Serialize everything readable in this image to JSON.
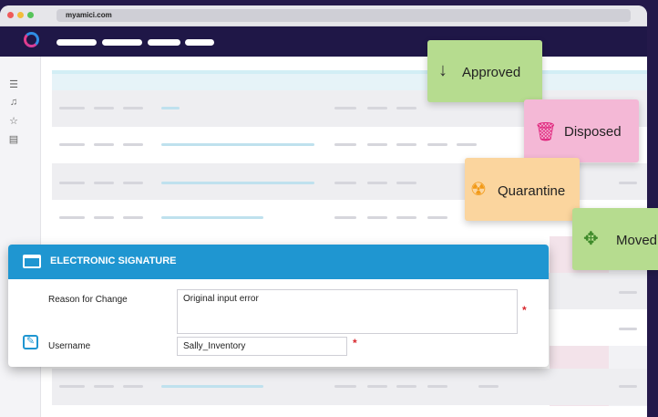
{
  "browser": {
    "url": "myamici.com"
  },
  "statuses": {
    "approved": {
      "label": "Approved",
      "icon": "down-arrow-icon",
      "color": "#b6dc8f"
    },
    "disposed": {
      "label": "Disposed",
      "icon": "trash-icon",
      "color": "#f4b8d6"
    },
    "quarantine": {
      "label": "Quarantine",
      "icon": "radiation-icon",
      "color": "#fbd59e"
    },
    "moved": {
      "label": "Moved",
      "icon": "move-arrows-icon",
      "color": "#b6dc8f"
    }
  },
  "esignature": {
    "title": "ELECTRONIC SIGNATURE",
    "reason_label": "Reason for Change",
    "reason_value": "Original input error",
    "username_label": "Username",
    "username_value": "Sally_Inventory",
    "required_marker": "*",
    "header_color": "#1f96d1"
  }
}
